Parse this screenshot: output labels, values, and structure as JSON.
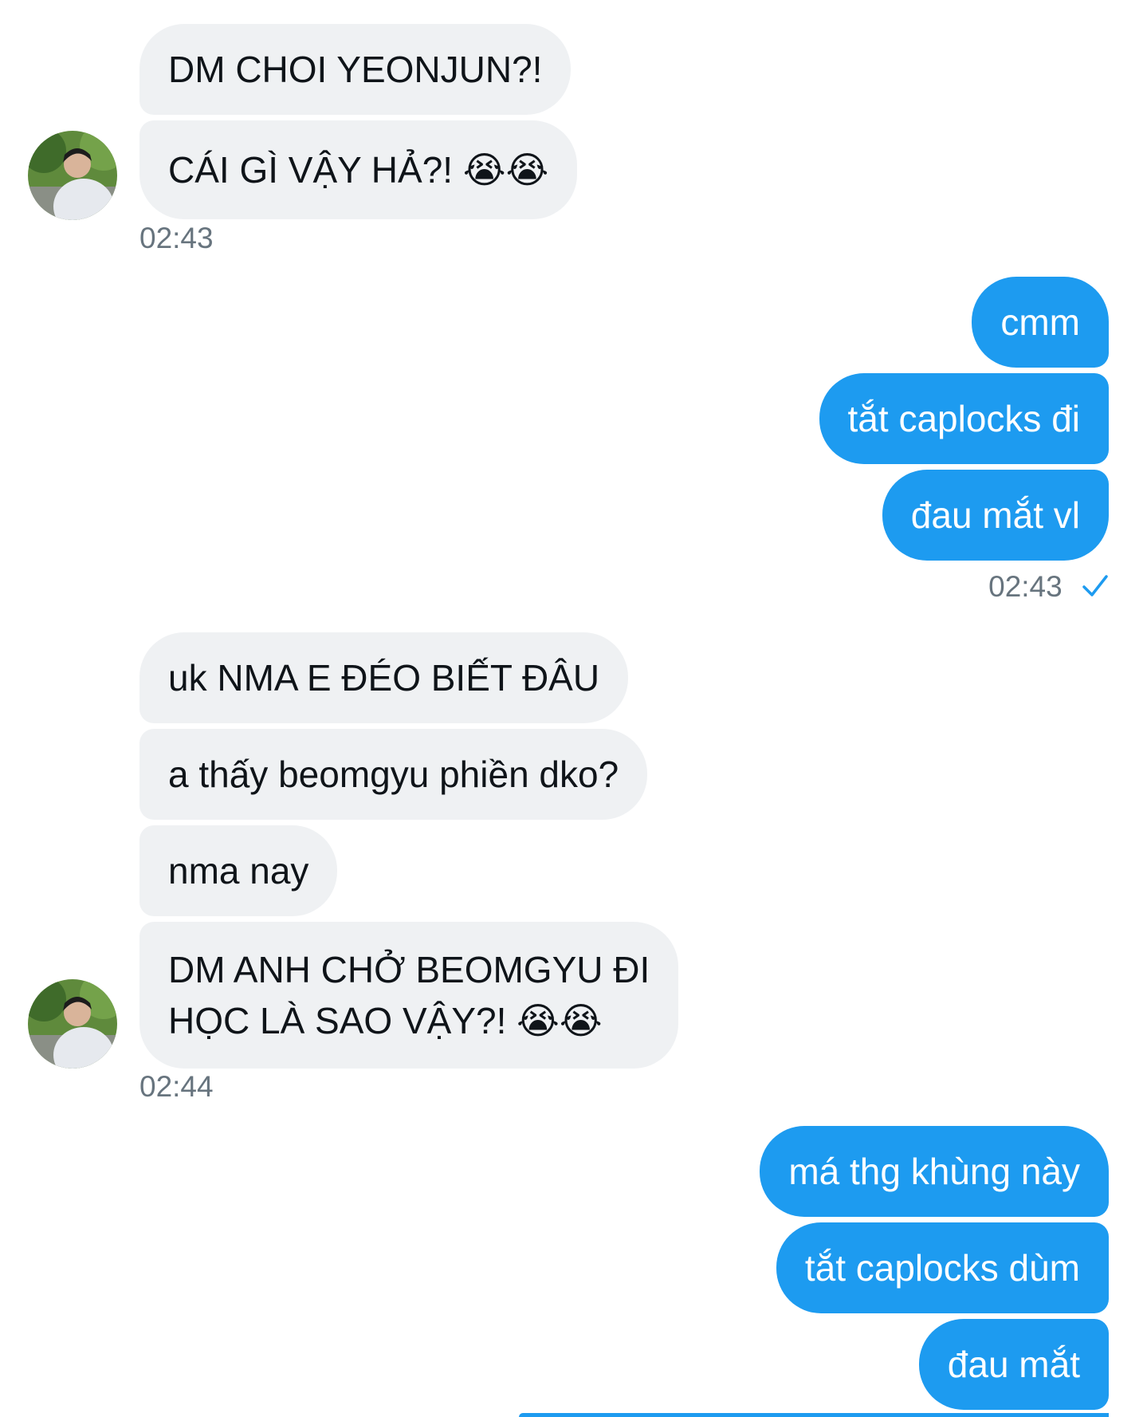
{
  "colors": {
    "incoming_bubble": "#eff1f3",
    "outgoing_bubble": "#1d9bf0",
    "timestamp": "#67747e",
    "check": "#1d9bf0"
  },
  "groups": [
    {
      "sender": "them",
      "messages": [
        "DM CHOI YEONJUN?!",
        "CÁI GÌ VẬY HẢ?! 😭😭"
      ],
      "time": "02:43"
    },
    {
      "sender": "me",
      "messages": [
        "cmm",
        "tắt caplocks đi",
        "đau mắt vl"
      ],
      "time": "02:43",
      "status_icon": "check-icon"
    },
    {
      "sender": "them",
      "messages": [
        "uk NMA E ĐÉO BIẾT ĐÂU",
        "a thấy beomgyu phiền dko?",
        "nma nay",
        "DM ANH CHỞ BEOMGYU ĐI HỌC LÀ SAO VẬY?! 😭😭"
      ],
      "time": "02:44"
    },
    {
      "sender": "me",
      "messages": [
        "má thg khùng này",
        "tắt caplocks dùm",
        "đau mắt"
      ]
    }
  ],
  "split_lines": {
    "g2m3_line1": "DM ANH CHỞ BEOMGYU ĐI",
    "g2m3_line2": "HỌC LÀ SAO VẬY?! 😭😭"
  }
}
